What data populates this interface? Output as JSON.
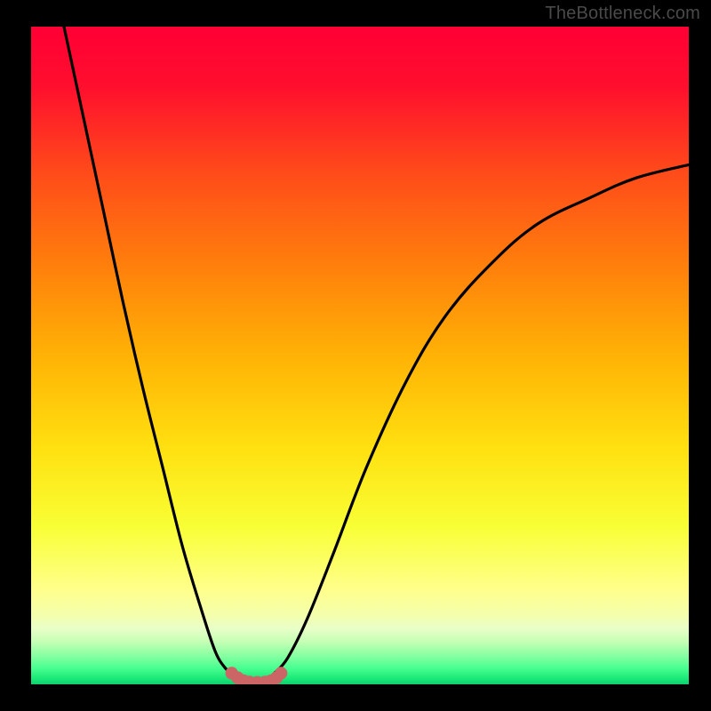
{
  "watermark": "TheBottleneck.com",
  "chart_data": {
    "type": "line",
    "title": "",
    "xlabel": "",
    "ylabel": "",
    "xlim": [
      0,
      100
    ],
    "ylim": [
      0,
      100
    ],
    "series": [
      {
        "name": "curve-left",
        "x": [
          5.0,
          8.0,
          11.0,
          14.0,
          17.0,
          20.0,
          23.0,
          26.0,
          28.0,
          29.5,
          30.5
        ],
        "values": [
          100,
          86,
          72,
          58,
          45,
          33,
          21,
          11,
          5,
          2.5,
          1.7
        ]
      },
      {
        "name": "curve-right",
        "x": [
          37.0,
          39.0,
          42.0,
          46.0,
          51.0,
          57.0,
          63.0,
          70.0,
          77.0,
          85.0,
          92.0,
          100.0
        ],
        "values": [
          1.7,
          4.0,
          10,
          20,
          33,
          46,
          56,
          64,
          70,
          74,
          77,
          79
        ]
      },
      {
        "name": "valley-dots",
        "x": [
          30.5,
          31.4,
          32.3,
          33.2,
          34.4,
          35.6,
          36.5,
          37.3,
          38.0
        ],
        "values": [
          1.7,
          1.0,
          0.55,
          0.35,
          0.3,
          0.35,
          0.55,
          1.0,
          1.7
        ]
      }
    ],
    "gradient_stops": [
      {
        "offset": 0.0,
        "color": "#ff0034"
      },
      {
        "offset": 0.09,
        "color": "#ff0e2e"
      },
      {
        "offset": 0.22,
        "color": "#ff4a1a"
      },
      {
        "offset": 0.36,
        "color": "#ff7e0c"
      },
      {
        "offset": 0.5,
        "color": "#ffb205"
      },
      {
        "offset": 0.64,
        "color": "#ffe010"
      },
      {
        "offset": 0.76,
        "color": "#f8ff35"
      },
      {
        "offset": 0.855,
        "color": "#ffff8a"
      },
      {
        "offset": 0.895,
        "color": "#f4ffad"
      },
      {
        "offset": 0.915,
        "color": "#e9ffc8"
      },
      {
        "offset": 0.935,
        "color": "#c6ffb5"
      },
      {
        "offset": 0.955,
        "color": "#8cffa3"
      },
      {
        "offset": 0.975,
        "color": "#4aff91"
      },
      {
        "offset": 0.992,
        "color": "#18e877"
      },
      {
        "offset": 1.0,
        "color": "#0fcf6e"
      }
    ],
    "colors": {
      "curve": "#000000",
      "dot_fill": "#cc6666",
      "dot_stroke": "#cc6666"
    }
  }
}
